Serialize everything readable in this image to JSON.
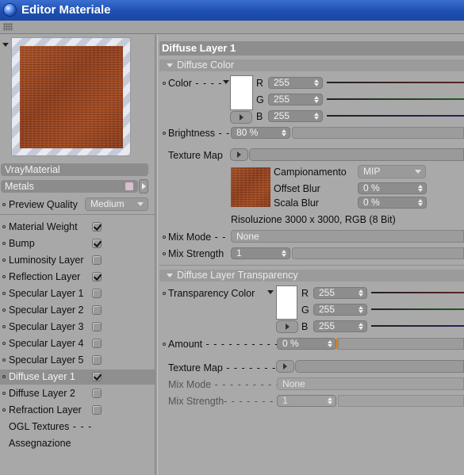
{
  "window": {
    "title": "Editor Materiale"
  },
  "left": {
    "material_name": "VrayMaterial",
    "category": "Metals",
    "preview_quality_label": "Preview Quality",
    "preview_quality_value": "Medium",
    "channels": [
      {
        "label": "Material Weight",
        "checked": true
      },
      {
        "label": "Bump",
        "checked": true
      },
      {
        "label": "Luminosity Layer",
        "checked": false
      },
      {
        "label": "Reflection Layer",
        "checked": true
      },
      {
        "label": "Specular Layer 1",
        "checked": false
      },
      {
        "label": "Specular Layer 2",
        "checked": false
      },
      {
        "label": "Specular Layer 3",
        "checked": false
      },
      {
        "label": "Specular Layer 4",
        "checked": false
      },
      {
        "label": "Specular Layer 5",
        "checked": false
      },
      {
        "label": "Diffuse Layer 1",
        "checked": true
      },
      {
        "label": "Diffuse Layer 2",
        "checked": false
      },
      {
        "label": "Refraction Layer",
        "checked": false
      }
    ],
    "ogl_textures": "OGL Textures",
    "assegnazione": "Assegnazione"
  },
  "right": {
    "header": "Diffuse Layer 1",
    "diffuse_color": {
      "section": "Diffuse Color",
      "color_label": "Color",
      "r_label": "R",
      "g_label": "G",
      "b_label": "B",
      "r": "255",
      "g": "255",
      "b": "255",
      "brightness_label": "Brightness",
      "brightness": "80 %",
      "texture_label": "Texture Map",
      "sampling_label": "Campionamento",
      "sampling_value": "MIP",
      "offset_label": "Offset Blur",
      "offset_value": "0 %",
      "scale_label": "Scala Blur",
      "scale_value": "0 %",
      "resolution": "Risoluzione 3000 x 3000, RGB (8 Bit)",
      "mix_mode_label": "Mix Mode",
      "mix_mode_value": "None",
      "mix_strength_label": "Mix Strength",
      "mix_strength_value": "1"
    },
    "transparency": {
      "section": "Diffuse Layer Transparency",
      "color_label": "Transparency Color",
      "r_label": "R",
      "g_label": "G",
      "b_label": "B",
      "r": "255",
      "g": "255",
      "b": "255",
      "amount_label": "Amount",
      "amount_value": "0 %",
      "texture_label": "Texture Map",
      "mix_mode_label": "Mix Mode",
      "mix_mode_value": "None",
      "mix_strength_label": "Mix Strength",
      "mix_strength_value": "1"
    }
  },
  "colors": {
    "titlebar": "#1d4fb0",
    "panel": "#a9a9a9",
    "wood": "#9a4a23",
    "orange_marker": "#e8860c"
  }
}
